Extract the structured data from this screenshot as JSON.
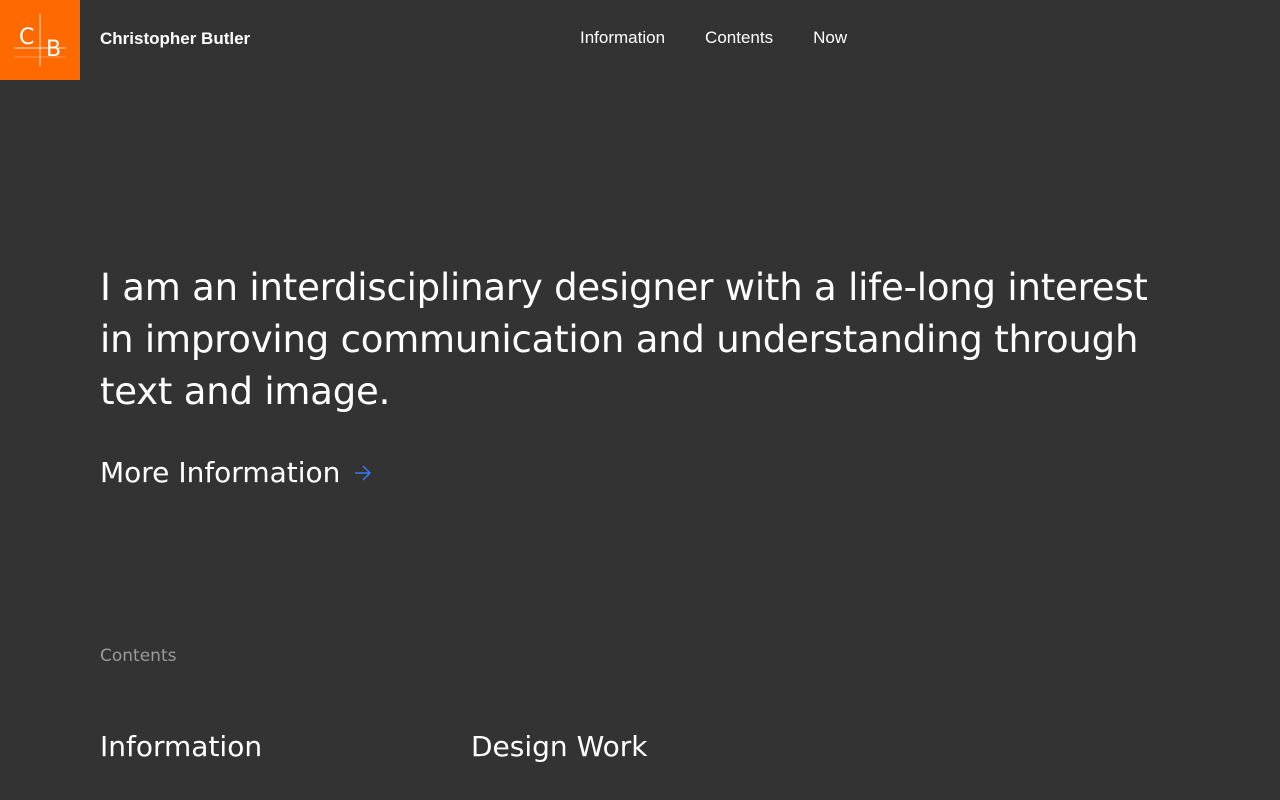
{
  "header": {
    "logo_letters": [
      "C",
      "B"
    ],
    "logo_color": "#ff6a00",
    "site_name": "Christopher Butler",
    "nav": [
      {
        "label": "Information"
      },
      {
        "label": "Contents"
      },
      {
        "label": "Now"
      }
    ]
  },
  "hero": {
    "statement": "I am an interdisciplinary designer with a life-long interest in improving communication and understanding through text and image.",
    "more_link_label": "More Information",
    "more_link_icon": "arrow-right-icon",
    "accent_color": "#3b7cff"
  },
  "contents": {
    "label": "Contents",
    "columns": [
      {
        "heading": "Information"
      },
      {
        "heading": "Design Work"
      }
    ]
  }
}
